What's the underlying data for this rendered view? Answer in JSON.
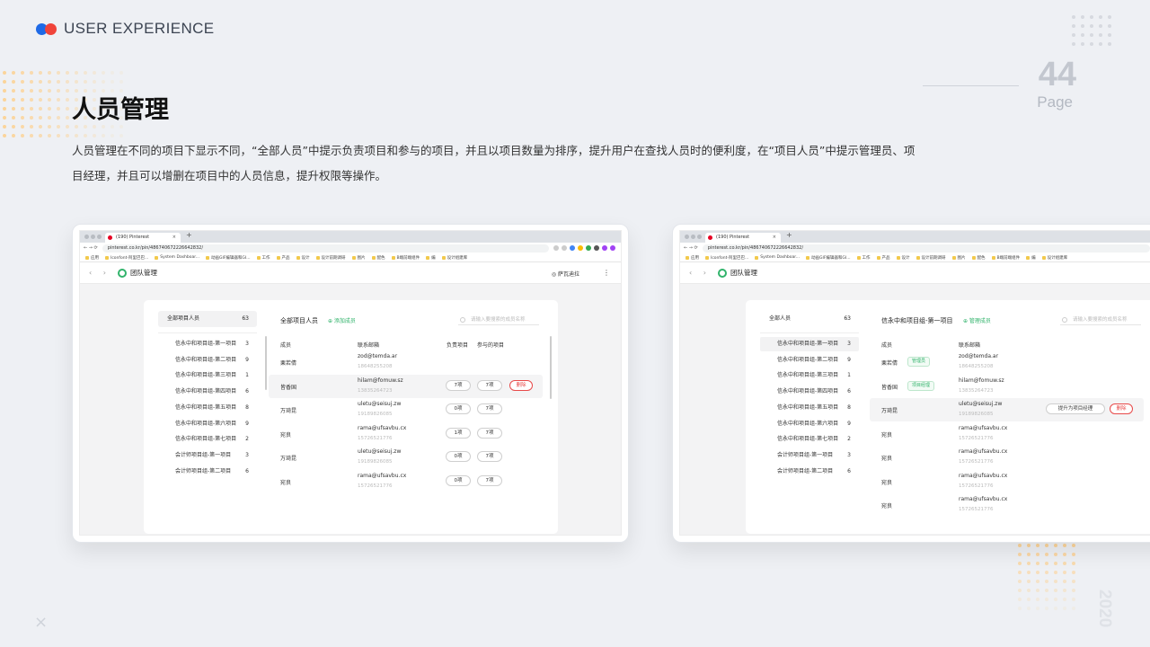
{
  "header": {
    "brand": "USER EXPERIENCE",
    "page_number": "44",
    "page_label": "Page",
    "year": "2020",
    "title": "人员管理",
    "description": "人员管理在不同的项目下显示不同，“全部人员”中提示负责项目和参与的项目，并且以项目数量为排序，提升用户在查找人员时的便利度，在“项目人员”中提示管理员、项目经理，并且可以增删在项目中的人员信息，提升权限等操作。",
    "close_glyph": "×"
  },
  "colors": {
    "brand_blue": "#1f6ae6",
    "brand_red": "#f0443a",
    "orange_dots": "#fbd49a",
    "accent_green": "#31b36b",
    "danger": "#e84a4a"
  },
  "browser": {
    "tab_title": "(190) Pinterest",
    "tab_close": "×",
    "new_tab": "+",
    "url": "pinterest.co.kr/pin/486740672226642832/",
    "bookmarks": [
      "应用",
      "Iconfont-阿里巴巴...",
      "System Dashboar...",
      "动画GIF编辑器和GI...",
      "工作",
      "产品",
      "设计",
      "设计前期调研",
      "图片",
      "配色",
      "B端前端组件",
      "编",
      "设计组建库"
    ]
  },
  "app": {
    "back": "‹ ›",
    "title": "团队管理",
    "user": "萨瓦迪拉",
    "more": "⋮"
  },
  "left_screen": {
    "sidebar_header": {
      "label": "全部项目人员",
      "count": "63"
    },
    "projects": [
      {
        "name": "信永中和项目组-第一项目",
        "count": "3"
      },
      {
        "name": "信永中和项目组-第二项目",
        "count": "9"
      },
      {
        "name": "信永中和项目组-第三项目",
        "count": "1"
      },
      {
        "name": "信永中和项目组-第四项目",
        "count": "6"
      },
      {
        "name": "信永中和项目组-第五项目",
        "count": "8"
      },
      {
        "name": "信永中和项目组-第六项目",
        "count": "9"
      },
      {
        "name": "信永中和项目组-第七项目",
        "count": "2"
      },
      {
        "name": "会计师项目组-第一项目",
        "count": "3"
      },
      {
        "name": "会计师项目组-第二项目",
        "count": "6"
      }
    ],
    "panel_title": "全部项目人员",
    "add_label": "⊕ 添加成员",
    "search_placeholder": "请输入要搜索的成员名称",
    "columns": {
      "member": "成员",
      "contact": "联系邮箱",
      "owned": "负责项目",
      "joined": "参与的项目"
    },
    "rows": [
      {
        "name": "栗若倩",
        "email": "zod@temda.ar",
        "phone": "18648255208",
        "owned": "",
        "joined": "",
        "action": ""
      },
      {
        "name": "皆香国",
        "email": "hilam@fomuw.sz",
        "phone": "13835264723",
        "owned": "7项",
        "joined": "7项",
        "action": "删除"
      },
      {
        "name": "万琦昆",
        "email": "uletu@seisuj.zw",
        "phone": "19189826085",
        "owned": "0项",
        "joined": "7项",
        "action": ""
      },
      {
        "name": "宛良",
        "email": "rama@ufsavbu.cx",
        "phone": "15726521776",
        "owned": "1项",
        "joined": "7项",
        "action": ""
      },
      {
        "name": "万琦昆",
        "email": "uletu@seisuj.zw",
        "phone": "19189826085",
        "owned": "0项",
        "joined": "7项",
        "action": ""
      },
      {
        "name": "宛良",
        "email": "rama@ufsavbu.cx",
        "phone": "15726521776",
        "owned": "0项",
        "joined": "7项",
        "action": ""
      }
    ]
  },
  "right_screen": {
    "sidebar_header": {
      "label": "全部人员",
      "count": "63"
    },
    "projects": [
      {
        "name": "信永中和项目组-第一项目",
        "count": "3"
      },
      {
        "name": "信永中和项目组-第二项目",
        "count": "9"
      },
      {
        "name": "信永中和项目组-第三项目",
        "count": "1"
      },
      {
        "name": "信永中和项目组-第四项目",
        "count": "6"
      },
      {
        "name": "信永中和项目组-第五项目",
        "count": "8"
      },
      {
        "name": "信永中和项目组-第六项目",
        "count": "9"
      },
      {
        "name": "信永中和项目组-第七项目",
        "count": "2"
      },
      {
        "name": "会计师项目组-第一项目",
        "count": "3"
      },
      {
        "name": "会计师项目组-第二项目",
        "count": "6"
      }
    ],
    "panel_title": "信永中和项目组-第一项目",
    "add_label": "⊕ 管理成员",
    "search_placeholder": "请输入要搜索的成员名称",
    "columns": {
      "member": "成员",
      "contact": "联系邮箱"
    },
    "rows": [
      {
        "name": "栗若倩",
        "tag": "管理员",
        "email": "zod@temda.ar",
        "phone": "18648255208"
      },
      {
        "name": "皆香国",
        "tag": "项目经理",
        "email": "hilam@fomuw.sz",
        "phone": "13835264723"
      },
      {
        "name": "万琦昆",
        "tag": "",
        "email": "uletu@seisuj.zw",
        "phone": "19189826085",
        "promote": "提升为项目经理",
        "delete": "删除"
      },
      {
        "name": "宛良",
        "tag": "",
        "email": "rama@ufsavbu.cx",
        "phone": "15726521776"
      },
      {
        "name": "宛良",
        "tag": "",
        "email": "rama@ufsavbu.cx",
        "phone": "15726521776"
      },
      {
        "name": "宛良",
        "tag": "",
        "email": "rama@ufsavbu.cx",
        "phone": "15726521776"
      },
      {
        "name": "宛良",
        "tag": "",
        "email": "rama@ufsavbu.cx",
        "phone": "15726521776"
      }
    ]
  }
}
